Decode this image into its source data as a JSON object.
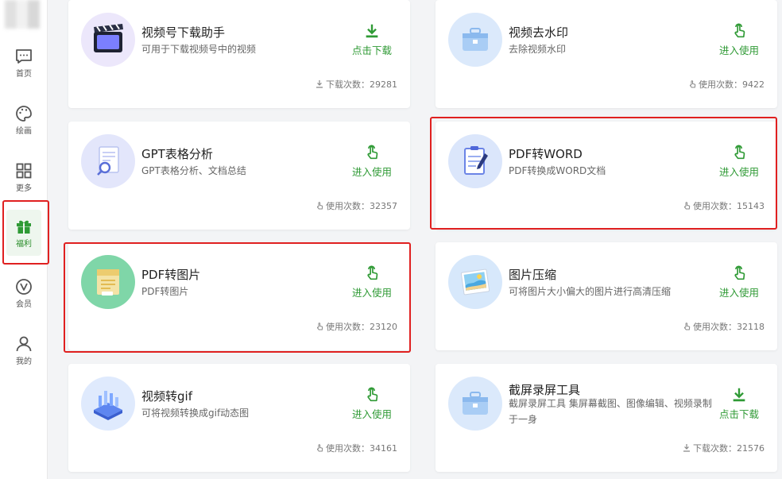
{
  "sidebar": {
    "items": [
      {
        "label": "首页",
        "icon": "chat-icon"
      },
      {
        "label": "绘画",
        "icon": "palette-icon"
      },
      {
        "label": "更多",
        "icon": "grid-icon"
      },
      {
        "label": "福利",
        "icon": "gift-icon",
        "active": true
      },
      {
        "label": "会员",
        "icon": "vip-icon"
      },
      {
        "label": "我的",
        "icon": "user-icon"
      }
    ]
  },
  "colors": {
    "accent": "#2f9a35",
    "highlight": "#e02020"
  },
  "cards": [
    {
      "title": "视频号下载助手",
      "desc": "可用于下载视频号中的视频",
      "action": "点击下载",
      "action_icon": "download-icon",
      "stat_label": "下载次数",
      "stat_value": "29281",
      "stat_text": "下载次数：29281"
    },
    {
      "title": "视频去水印",
      "desc": "去除视频水印",
      "action": "进入使用",
      "action_icon": "tap-icon",
      "stat_label": "使用次数",
      "stat_value": "9422",
      "stat_text": "使用次数：9422"
    },
    {
      "title": "GPT表格分析",
      "desc": "GPT表格分析、文档总结",
      "action": "进入使用",
      "action_icon": "tap-icon",
      "stat_label": "使用次数",
      "stat_value": "32357",
      "stat_text": "使用次数：32357"
    },
    {
      "title": "PDF转WORD",
      "desc": "PDF转换成WORD文档",
      "action": "进入使用",
      "action_icon": "tap-icon",
      "stat_label": "使用次数",
      "stat_value": "15143",
      "stat_text": "使用次数：15143"
    },
    {
      "title": "PDF转图片",
      "desc": "PDF转图片",
      "action": "进入使用",
      "action_icon": "tap-icon",
      "stat_label": "使用次数",
      "stat_value": "23120",
      "stat_text": "使用次数：23120"
    },
    {
      "title": "图片压缩",
      "desc": "可将图片大小偏大的图片进行高清压缩",
      "action": "进入使用",
      "action_icon": "tap-icon",
      "stat_label": "使用次数",
      "stat_value": "32118",
      "stat_text": "使用次数：32118"
    },
    {
      "title": "视频转gif",
      "desc": "可将视频转换成gif动态图",
      "action": "进入使用",
      "action_icon": "tap-icon",
      "stat_label": "使用次数",
      "stat_value": "34161",
      "stat_text": "使用次数：34161"
    },
    {
      "title": "截屏录屏工具",
      "desc": "截屏录屏工具 集屏幕截图、图像编辑、视频录制于一身",
      "action": "点击下载",
      "action_icon": "download-icon",
      "stat_label": "下载次数",
      "stat_value": "21576",
      "stat_text": "下载次数：21576"
    }
  ]
}
